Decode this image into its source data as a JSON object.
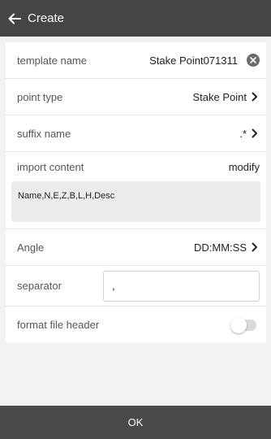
{
  "header": {
    "back_icon": "arrow-left-icon",
    "title": "Create"
  },
  "form": {
    "template_name": {
      "label": "template name",
      "value": "Stake Point071311"
    },
    "point_type": {
      "label": "point type",
      "value": "Stake Point"
    },
    "suffix_name": {
      "label": "suffix name",
      "value": ".*"
    },
    "import_content": {
      "label": "import content",
      "action": "modify",
      "content": "Name,N,E,Z,B,L,H,Desc"
    },
    "angle": {
      "label": "Angle",
      "value": "DD:MM:SS"
    },
    "separator": {
      "label": "separator",
      "value": ","
    },
    "format_file_header": {
      "label": "format file header",
      "enabled": false
    }
  },
  "footer": {
    "ok_label": "OK"
  },
  "colors": {
    "accent": "#f5a623",
    "topbar": "#454545",
    "footer": "#4a4a4a"
  }
}
